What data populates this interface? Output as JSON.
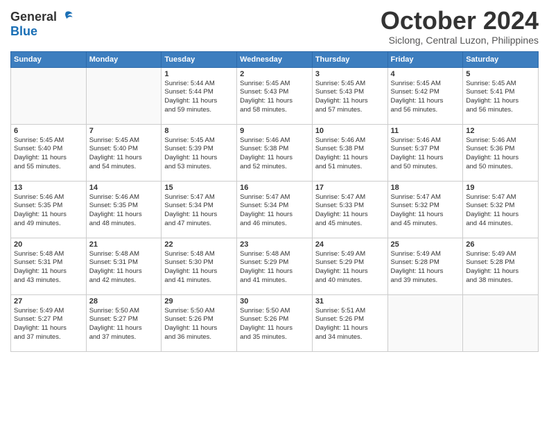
{
  "header": {
    "logo_general": "General",
    "logo_blue": "Blue",
    "month": "October 2024",
    "location": "Siclong, Central Luzon, Philippines"
  },
  "days": [
    "Sunday",
    "Monday",
    "Tuesday",
    "Wednesday",
    "Thursday",
    "Friday",
    "Saturday"
  ],
  "weeks": [
    [
      {
        "day": "",
        "lines": []
      },
      {
        "day": "",
        "lines": []
      },
      {
        "day": "1",
        "lines": [
          "Sunrise: 5:44 AM",
          "Sunset: 5:44 PM",
          "Daylight: 11 hours",
          "and 59 minutes."
        ]
      },
      {
        "day": "2",
        "lines": [
          "Sunrise: 5:45 AM",
          "Sunset: 5:43 PM",
          "Daylight: 11 hours",
          "and 58 minutes."
        ]
      },
      {
        "day": "3",
        "lines": [
          "Sunrise: 5:45 AM",
          "Sunset: 5:43 PM",
          "Daylight: 11 hours",
          "and 57 minutes."
        ]
      },
      {
        "day": "4",
        "lines": [
          "Sunrise: 5:45 AM",
          "Sunset: 5:42 PM",
          "Daylight: 11 hours",
          "and 56 minutes."
        ]
      },
      {
        "day": "5",
        "lines": [
          "Sunrise: 5:45 AM",
          "Sunset: 5:41 PM",
          "Daylight: 11 hours",
          "and 56 minutes."
        ]
      }
    ],
    [
      {
        "day": "6",
        "lines": [
          "Sunrise: 5:45 AM",
          "Sunset: 5:40 PM",
          "Daylight: 11 hours",
          "and 55 minutes."
        ]
      },
      {
        "day": "7",
        "lines": [
          "Sunrise: 5:45 AM",
          "Sunset: 5:40 PM",
          "Daylight: 11 hours",
          "and 54 minutes."
        ]
      },
      {
        "day": "8",
        "lines": [
          "Sunrise: 5:45 AM",
          "Sunset: 5:39 PM",
          "Daylight: 11 hours",
          "and 53 minutes."
        ]
      },
      {
        "day": "9",
        "lines": [
          "Sunrise: 5:46 AM",
          "Sunset: 5:38 PM",
          "Daylight: 11 hours",
          "and 52 minutes."
        ]
      },
      {
        "day": "10",
        "lines": [
          "Sunrise: 5:46 AM",
          "Sunset: 5:38 PM",
          "Daylight: 11 hours",
          "and 51 minutes."
        ]
      },
      {
        "day": "11",
        "lines": [
          "Sunrise: 5:46 AM",
          "Sunset: 5:37 PM",
          "Daylight: 11 hours",
          "and 50 minutes."
        ]
      },
      {
        "day": "12",
        "lines": [
          "Sunrise: 5:46 AM",
          "Sunset: 5:36 PM",
          "Daylight: 11 hours",
          "and 50 minutes."
        ]
      }
    ],
    [
      {
        "day": "13",
        "lines": [
          "Sunrise: 5:46 AM",
          "Sunset: 5:35 PM",
          "Daylight: 11 hours",
          "and 49 minutes."
        ]
      },
      {
        "day": "14",
        "lines": [
          "Sunrise: 5:46 AM",
          "Sunset: 5:35 PM",
          "Daylight: 11 hours",
          "and 48 minutes."
        ]
      },
      {
        "day": "15",
        "lines": [
          "Sunrise: 5:47 AM",
          "Sunset: 5:34 PM",
          "Daylight: 11 hours",
          "and 47 minutes."
        ]
      },
      {
        "day": "16",
        "lines": [
          "Sunrise: 5:47 AM",
          "Sunset: 5:34 PM",
          "Daylight: 11 hours",
          "and 46 minutes."
        ]
      },
      {
        "day": "17",
        "lines": [
          "Sunrise: 5:47 AM",
          "Sunset: 5:33 PM",
          "Daylight: 11 hours",
          "and 45 minutes."
        ]
      },
      {
        "day": "18",
        "lines": [
          "Sunrise: 5:47 AM",
          "Sunset: 5:32 PM",
          "Daylight: 11 hours",
          "and 45 minutes."
        ]
      },
      {
        "day": "19",
        "lines": [
          "Sunrise: 5:47 AM",
          "Sunset: 5:32 PM",
          "Daylight: 11 hours",
          "and 44 minutes."
        ]
      }
    ],
    [
      {
        "day": "20",
        "lines": [
          "Sunrise: 5:48 AM",
          "Sunset: 5:31 PM",
          "Daylight: 11 hours",
          "and 43 minutes."
        ]
      },
      {
        "day": "21",
        "lines": [
          "Sunrise: 5:48 AM",
          "Sunset: 5:31 PM",
          "Daylight: 11 hours",
          "and 42 minutes."
        ]
      },
      {
        "day": "22",
        "lines": [
          "Sunrise: 5:48 AM",
          "Sunset: 5:30 PM",
          "Daylight: 11 hours",
          "and 41 minutes."
        ]
      },
      {
        "day": "23",
        "lines": [
          "Sunrise: 5:48 AM",
          "Sunset: 5:29 PM",
          "Daylight: 11 hours",
          "and 41 minutes."
        ]
      },
      {
        "day": "24",
        "lines": [
          "Sunrise: 5:49 AM",
          "Sunset: 5:29 PM",
          "Daylight: 11 hours",
          "and 40 minutes."
        ]
      },
      {
        "day": "25",
        "lines": [
          "Sunrise: 5:49 AM",
          "Sunset: 5:28 PM",
          "Daylight: 11 hours",
          "and 39 minutes."
        ]
      },
      {
        "day": "26",
        "lines": [
          "Sunrise: 5:49 AM",
          "Sunset: 5:28 PM",
          "Daylight: 11 hours",
          "and 38 minutes."
        ]
      }
    ],
    [
      {
        "day": "27",
        "lines": [
          "Sunrise: 5:49 AM",
          "Sunset: 5:27 PM",
          "Daylight: 11 hours",
          "and 37 minutes."
        ]
      },
      {
        "day": "28",
        "lines": [
          "Sunrise: 5:50 AM",
          "Sunset: 5:27 PM",
          "Daylight: 11 hours",
          "and 37 minutes."
        ]
      },
      {
        "day": "29",
        "lines": [
          "Sunrise: 5:50 AM",
          "Sunset: 5:26 PM",
          "Daylight: 11 hours",
          "and 36 minutes."
        ]
      },
      {
        "day": "30",
        "lines": [
          "Sunrise: 5:50 AM",
          "Sunset: 5:26 PM",
          "Daylight: 11 hours",
          "and 35 minutes."
        ]
      },
      {
        "day": "31",
        "lines": [
          "Sunrise: 5:51 AM",
          "Sunset: 5:26 PM",
          "Daylight: 11 hours",
          "and 34 minutes."
        ]
      },
      {
        "day": "",
        "lines": []
      },
      {
        "day": "",
        "lines": []
      }
    ]
  ]
}
